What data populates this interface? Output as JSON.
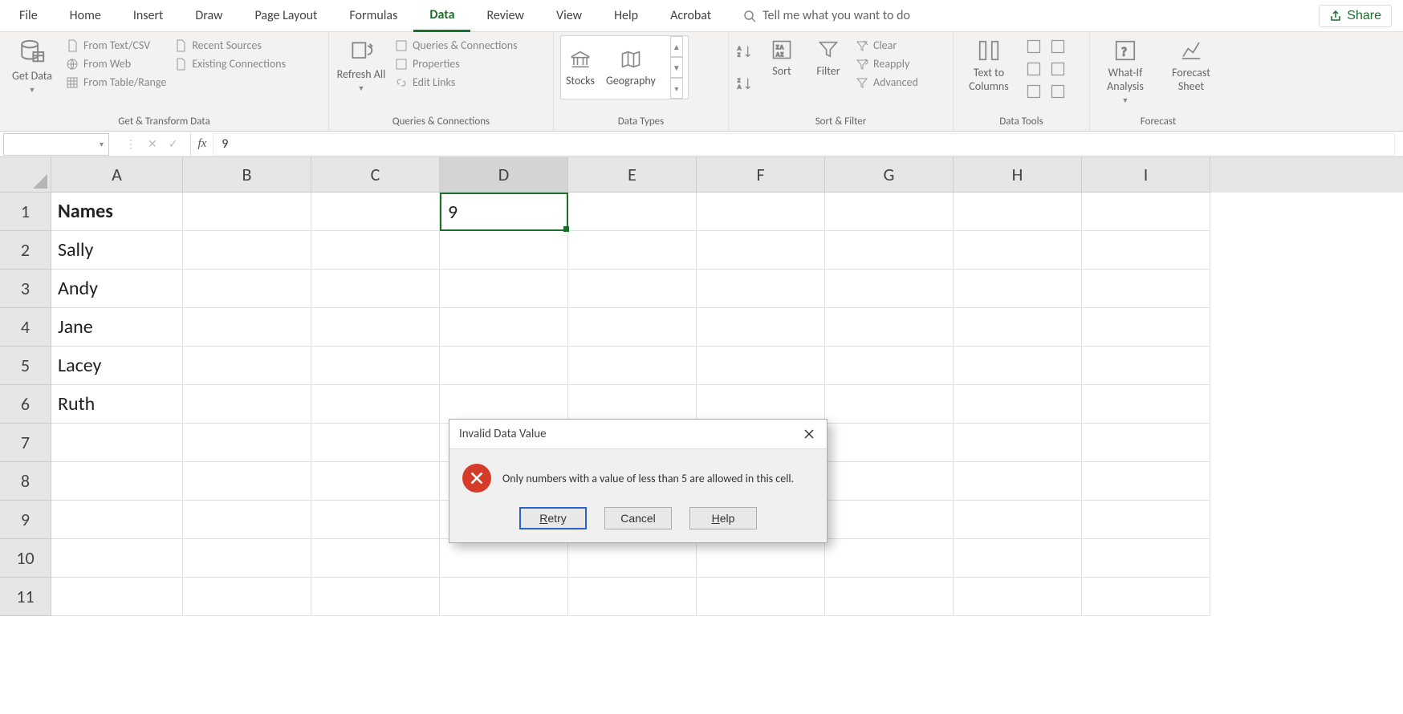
{
  "tabs": {
    "items": [
      "File",
      "Home",
      "Insert",
      "Draw",
      "Page Layout",
      "Formulas",
      "Data",
      "Review",
      "View",
      "Help",
      "Acrobat"
    ],
    "active": "Data",
    "tellme": "Tell me what you want to do",
    "share": "Share"
  },
  "ribbon": {
    "groups": {
      "getTransform": {
        "label": "Get & Transform Data",
        "getData": "Get Data",
        "items": [
          "From Text/CSV",
          "From Web",
          "From Table/Range",
          "Recent Sources",
          "Existing Connections"
        ]
      },
      "queries": {
        "label": "Queries & Connections",
        "refresh": "Refresh All",
        "items": [
          "Queries & Connections",
          "Properties",
          "Edit Links"
        ]
      },
      "dataTypes": {
        "label": "Data Types",
        "stocks": "Stocks",
        "geography": "Geography"
      },
      "sortFilter": {
        "label": "Sort & Filter",
        "sort": "Sort",
        "filter": "Filter",
        "clear": "Clear",
        "reapply": "Reapply",
        "advanced": "Advanced"
      },
      "dataTools": {
        "label": "Data Tools",
        "textToColumns": "Text to Columns"
      },
      "forecast": {
        "label": "Forecast",
        "whatIf": "What-If Analysis",
        "sheet": "Forecast Sheet"
      }
    }
  },
  "formulaBar": {
    "nameBox": "",
    "fx": "fx",
    "value": "9"
  },
  "grid": {
    "columns": [
      "A",
      "B",
      "C",
      "D",
      "E",
      "F",
      "G",
      "H",
      "I"
    ],
    "rows": [
      "1",
      "2",
      "3",
      "4",
      "5",
      "6",
      "7",
      "8",
      "9",
      "10",
      "11"
    ],
    "selectedColumn": "D",
    "cells": {
      "A1": "Names",
      "A2": "Sally",
      "A3": "Andy",
      "A4": "Jane",
      "A5": "Lacey",
      "A6": "Ruth",
      "D1": "9"
    }
  },
  "dialog": {
    "title": "Invalid Data Value",
    "message": "Only numbers with a value of less than 5 are allowed in this cell.",
    "buttons": {
      "retry": "Retry",
      "cancel": "Cancel",
      "help": "Help"
    }
  }
}
